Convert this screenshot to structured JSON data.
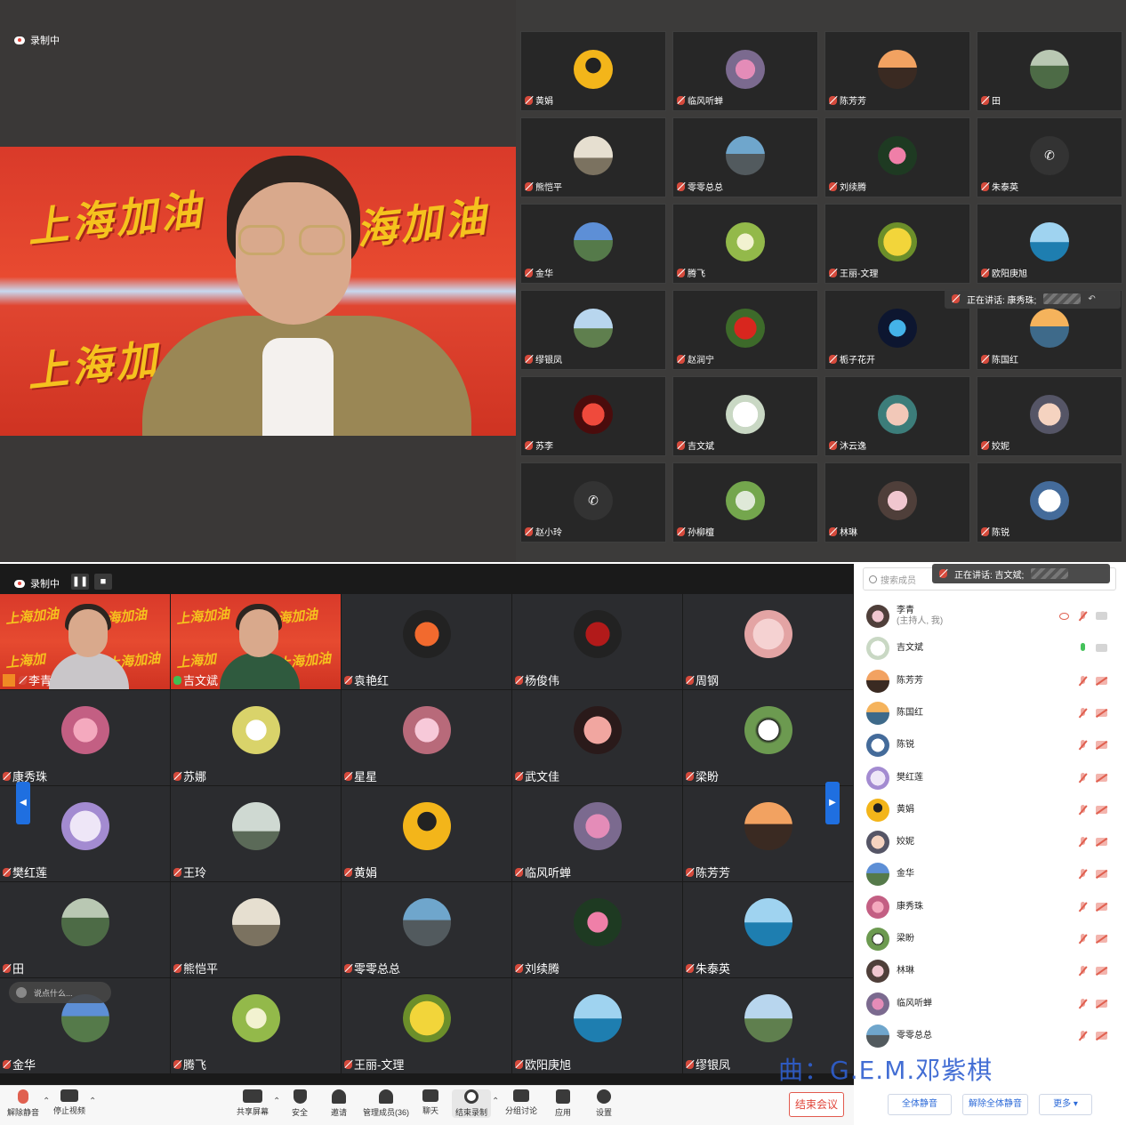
{
  "top_panel": {
    "recording_label": "录制中",
    "speaking_label": "正在讲话: 康秀珠;",
    "main_video_banner_1": "上海加油",
    "main_video_banner_2": "海加油",
    "main_video_banner_3": "上海加",
    "grid": [
      {
        "name": "黄娟",
        "avatar": "c1"
      },
      {
        "name": "临风听蝉",
        "avatar": "c2"
      },
      {
        "name": "陈芳芳",
        "avatar": "c3"
      },
      {
        "name": "田",
        "avatar": "c4"
      },
      {
        "name": "熊恺平",
        "avatar": "c5"
      },
      {
        "name": "零零总总",
        "avatar": "c6"
      },
      {
        "name": "刘续腾",
        "avatar": "c7"
      },
      {
        "name": "朱泰英",
        "avatar": "c8",
        "phone": true
      },
      {
        "name": "金华",
        "avatar": "c9"
      },
      {
        "name": "腾飞",
        "avatar": "c10"
      },
      {
        "name": "王丽-文理",
        "avatar": "c11"
      },
      {
        "name": "欧阳庚旭",
        "avatar": "c12"
      },
      {
        "name": "缪银凤",
        "avatar": "c13"
      },
      {
        "name": "赵润宁",
        "avatar": "c14"
      },
      {
        "name": "栀子花开",
        "avatar": "c15"
      },
      {
        "name": "陈国红",
        "avatar": "c16"
      },
      {
        "name": "苏李",
        "avatar": "c17"
      },
      {
        "name": "吉文斌",
        "avatar": "c18"
      },
      {
        "name": "沐云逸",
        "avatar": "c19"
      },
      {
        "name": "姣妮",
        "avatar": "c20"
      },
      {
        "name": "赵小玲",
        "avatar": "c8",
        "phone": true
      },
      {
        "name": "孙柳檀",
        "avatar": "c21"
      },
      {
        "name": "林琳",
        "avatar": "c22"
      },
      {
        "name": "陈锐",
        "avatar": "c23"
      }
    ]
  },
  "bottom_panel": {
    "recording_label": "录制中",
    "pause_icon": "pause-icon",
    "stop_icon": "stop-icon",
    "speaking_label": "正在讲话: 吉文斌;",
    "chat_placeholder": "说点什么...",
    "watermark": "曲：G.E.M.邓紫棋",
    "grid": [
      {
        "name": "李青",
        "video": true,
        "host": true
      },
      {
        "name": "吉文斌",
        "video": true,
        "mic_on": true
      },
      {
        "name": "袁艳红",
        "avatar": "c24"
      },
      {
        "name": "杨俊伟",
        "avatar": "c25"
      },
      {
        "name": "周钢",
        "avatar": "c26"
      },
      {
        "name": "康秀珠",
        "avatar": "c27"
      },
      {
        "name": "苏娜",
        "avatar": "c28"
      },
      {
        "name": "星星",
        "avatar": "c29"
      },
      {
        "name": "武文佳",
        "avatar": "c30"
      },
      {
        "name": "梁盼",
        "avatar": "c31"
      },
      {
        "name": "樊红莲",
        "avatar": "c32"
      },
      {
        "name": "王玲",
        "avatar": "c33"
      },
      {
        "name": "黄娟",
        "avatar": "c1"
      },
      {
        "name": "临风听蝉",
        "avatar": "c2"
      },
      {
        "name": "陈芳芳",
        "avatar": "c3"
      },
      {
        "name": "田",
        "avatar": "c4"
      },
      {
        "name": "熊恺平",
        "avatar": "c5"
      },
      {
        "name": "零零总总",
        "avatar": "c6"
      },
      {
        "name": "刘续腾",
        "avatar": "c7"
      },
      {
        "name": "朱泰英",
        "avatar": "c12"
      },
      {
        "name": "金华",
        "avatar": "c9"
      },
      {
        "name": "腾飞",
        "avatar": "c10"
      },
      {
        "name": "王丽-文理",
        "avatar": "c11"
      },
      {
        "name": "欧阳庚旭",
        "avatar": "c12"
      },
      {
        "name": "缪银凤",
        "avatar": "c13"
      }
    ],
    "toolbar": {
      "unmute": "解除静音",
      "stop_video": "停止视频",
      "share_screen": "共享屏幕",
      "security": "安全",
      "invite": "邀请",
      "manage_members": "管理成员(36)",
      "chat": "聊天",
      "end_recording": "结束录制",
      "breakout": "分组讨论",
      "apps": "应用",
      "settings": "设置",
      "end_meeting": "结束会议"
    },
    "members_panel": {
      "search_placeholder": "搜索成员",
      "members": [
        {
          "name": "李青",
          "sub": "(主持人, 我)",
          "avatar": "c22",
          "eye": true,
          "mic_on": false,
          "cam_on": true
        },
        {
          "name": "吉文斌",
          "avatar": "c18",
          "mic_on": true,
          "cam_on": true
        },
        {
          "name": "陈芳芳",
          "avatar": "c3"
        },
        {
          "name": "陈国红",
          "avatar": "c16"
        },
        {
          "name": "陈锐",
          "avatar": "c23"
        },
        {
          "name": "樊红莲",
          "avatar": "c32"
        },
        {
          "name": "黄娟",
          "avatar": "c1"
        },
        {
          "name": "姣妮",
          "avatar": "c20"
        },
        {
          "name": "金华",
          "avatar": "c9"
        },
        {
          "name": "康秀珠",
          "avatar": "c27"
        },
        {
          "name": "梁盼",
          "avatar": "c31"
        },
        {
          "name": "林琳",
          "avatar": "c22"
        },
        {
          "name": "临风听蝉",
          "avatar": "c2"
        },
        {
          "name": "零零总总",
          "avatar": "c6"
        }
      ],
      "mute_all": "全体静音",
      "unmute_all": "解除全体静音",
      "more": "更多 ▾"
    }
  }
}
